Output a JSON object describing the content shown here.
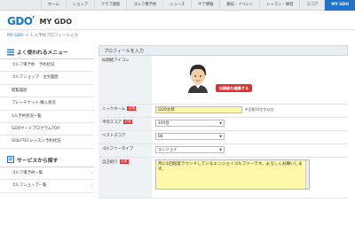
{
  "nav": {
    "tabs": [
      "ホーム",
      "ショップ",
      "クラブ買取",
      "ゴルフ場予約",
      "ニュース",
      "ギア情報",
      "競技・イベント",
      "レッスン・練習",
      "スコア",
      "MY GDO"
    ],
    "active": "MY GDO"
  },
  "header": {
    "logo": "GDO",
    "logo_mark": "r",
    "title": "MY GDO"
  },
  "breadcrumb": {
    "home": "MY GDO",
    "sep": ">",
    "current": "1.入予約プロフィール入力"
  },
  "sidebar": {
    "section1": {
      "title": "よく使われるメニュー",
      "items": [
        "ゴルフ場予約　予約状況",
        "ゴルフショップ　注文履歴",
        "閲覧履歴",
        "プレーチケット 購入状況",
        "1人予約状況一覧",
        "GDOヤードプログラムTOP",
        "GOLFTECレッスン予約状況"
      ]
    },
    "section2": {
      "title": "サービスから探す",
      "items": [
        "ゴルフ場予約一覧",
        "ゴルフショップ一覧"
      ]
    },
    "chevron": "›",
    "accent_color": "#1f74c9"
  },
  "form": {
    "header": "プロフィールを入力",
    "required_badge": "必須",
    "avatar": {
      "label": "似顔絵アイコン",
      "button": "似顔絵を編集する"
    },
    "nickname": {
      "label": "ニックネーム",
      "value": "GDO太郎",
      "hint": "※全角10文字以内"
    },
    "average_score": {
      "label": "平均スコア",
      "value": "100台"
    },
    "best_score": {
      "label": "ベストスコア",
      "value": "88"
    },
    "golfer_type": {
      "label": "ゴルファータイプ",
      "value": "エンジョイ"
    },
    "self_intro": {
      "label": "自己紹介",
      "value": "月に1回程度ラウンドしているエンジョイゴルファーです。よろしくお願いします。"
    },
    "dropdown_arrow": "▼"
  }
}
